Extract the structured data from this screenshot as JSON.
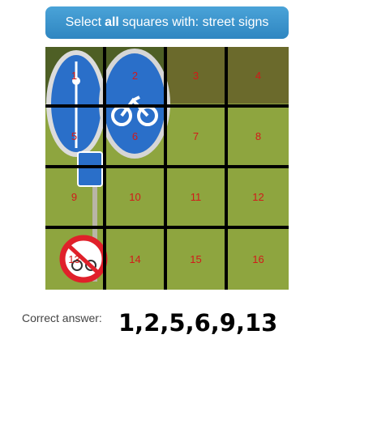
{
  "header": {
    "prefix": "Select",
    "emphasis": "all",
    "suffix": "squares with: street signs",
    "color": "#3a93cf"
  },
  "grid": {
    "cells": [
      "1",
      "2",
      "3",
      "4",
      "5",
      "6",
      "7",
      "8",
      "9",
      "10",
      "11",
      "12",
      "13",
      "14",
      "15",
      "16"
    ],
    "label_color": "#d21a1a"
  },
  "answer": {
    "label": "Correct answer:",
    "value": "1,2,5,6,9,13"
  }
}
